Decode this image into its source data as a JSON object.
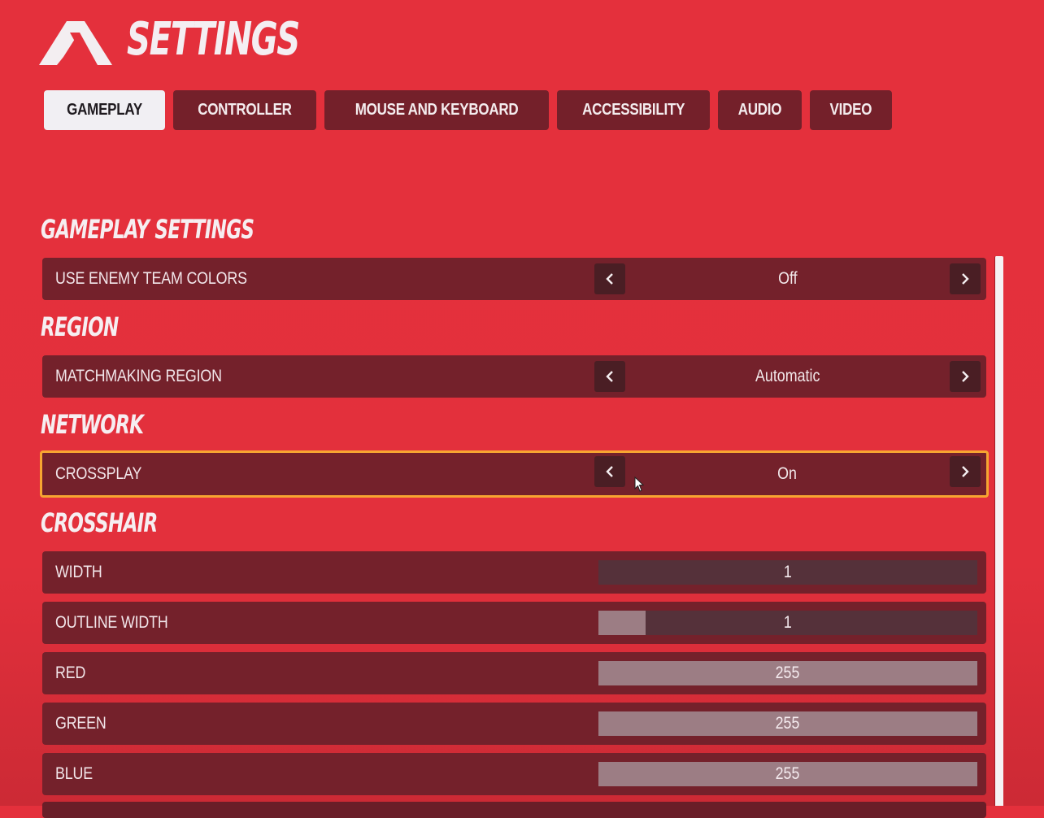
{
  "header": {
    "title": "SETTINGS",
    "logo_icon": "mountain-logo-icon"
  },
  "tabs": [
    {
      "label": "GAMEPLAY",
      "active": true
    },
    {
      "label": "CONTROLLER",
      "active": false
    },
    {
      "label": "MOUSE AND KEYBOARD",
      "active": false
    },
    {
      "label": "ACCESSIBILITY",
      "active": false
    },
    {
      "label": "AUDIO",
      "active": false
    },
    {
      "label": "VIDEO",
      "active": false
    }
  ],
  "sections": {
    "gameplay": {
      "title": "GAMEPLAY SETTINGS",
      "use_enemy_team_colors": {
        "label": "USE ENEMY TEAM COLORS",
        "value": "Off"
      }
    },
    "region": {
      "title": "REGION",
      "matchmaking_region": {
        "label": "MATCHMAKING REGION",
        "value": "Automatic"
      }
    },
    "network": {
      "title": "NETWORK",
      "crossplay": {
        "label": "CROSSPLAY",
        "value": "On",
        "focused": true
      }
    },
    "crosshair": {
      "title": "CROSSHAIR",
      "sliders": [
        {
          "label": "WIDTH",
          "value": "1",
          "fill_fraction": 0.0
        },
        {
          "label": "OUTLINE WIDTH",
          "value": "1",
          "fill_fraction": 0.125
        },
        {
          "label": "RED",
          "value": "255",
          "fill_fraction": 1.0
        },
        {
          "label": "GREEN",
          "value": "255",
          "fill_fraction": 1.0
        },
        {
          "label": "BLUE",
          "value": "255",
          "fill_fraction": 1.0
        }
      ]
    }
  },
  "colors": {
    "background": "#e4303c",
    "row": "#74212b",
    "focus_border": "#f7a531",
    "active_tab": "#f1eff3",
    "slider_track": "#55313a",
    "slider_fill": "#9c7d84"
  }
}
